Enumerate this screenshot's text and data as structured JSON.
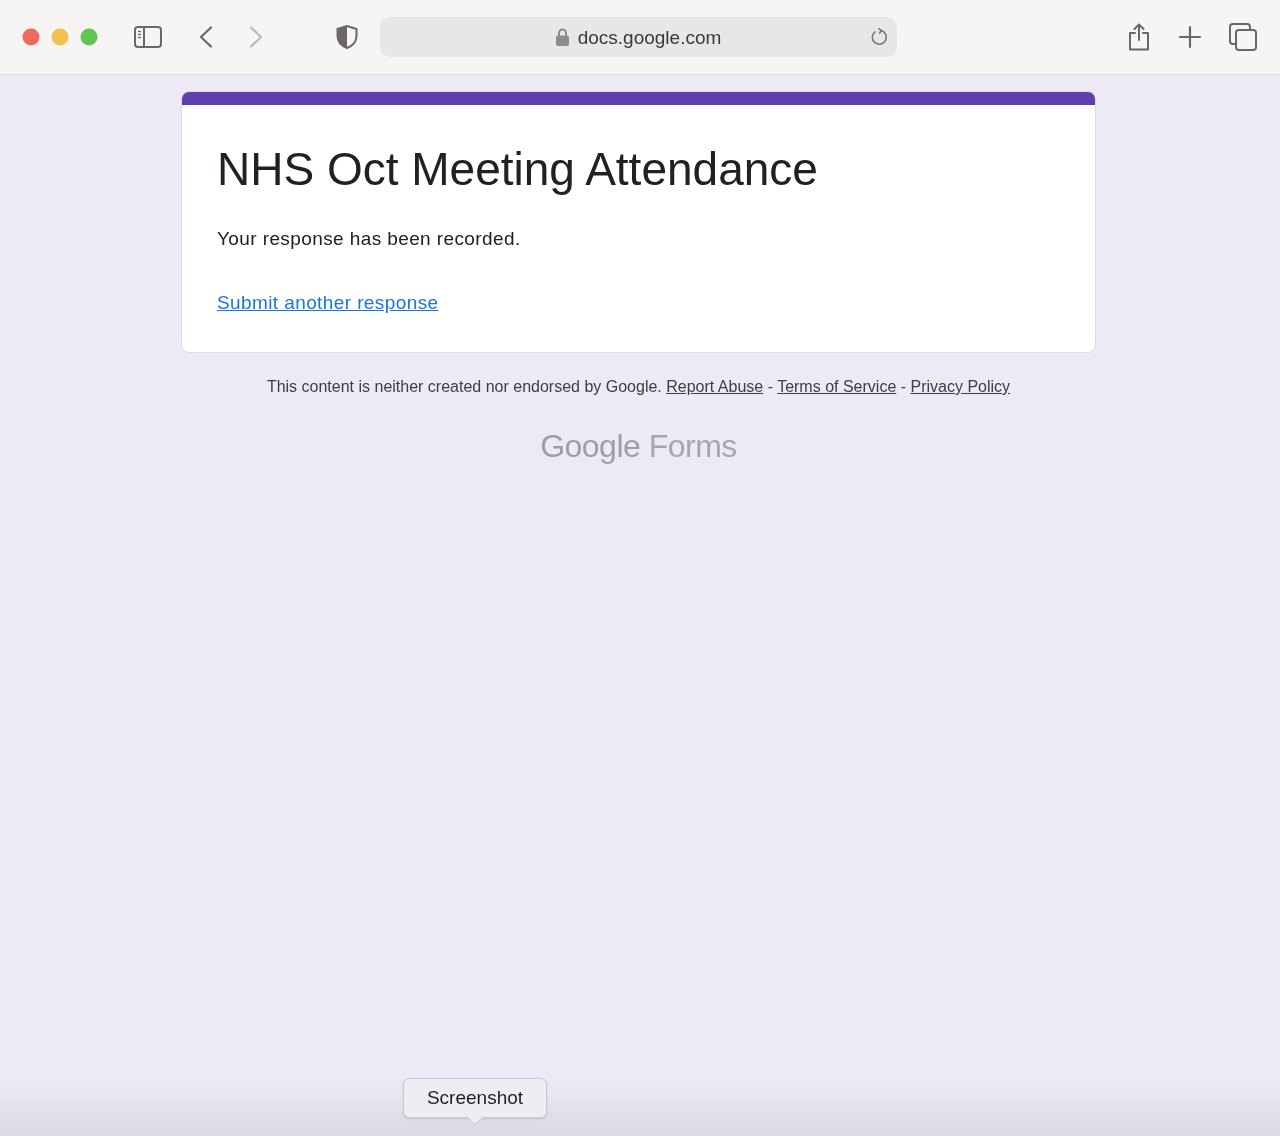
{
  "browser": {
    "url": "docs.google.com",
    "back": {
      "disabled": false
    },
    "forward": {
      "disabled": true
    }
  },
  "form": {
    "title": "NHS Oct Meeting Attendance",
    "confirmation": "Your response has been recorded.",
    "link": "Submit another response"
  },
  "footer": {
    "notice": [
      {
        "kind": "text",
        "text": "This content is neither created nor endorsed by Google."
      },
      {
        "kind": "link",
        "text": "Report Abuse"
      },
      {
        "kind": "text",
        "text": "-"
      },
      {
        "kind": "link",
        "text": "Terms of Service"
      },
      {
        "kind": "text",
        "text": "-"
      },
      {
        "kind": "link",
        "text": "Privacy Policy"
      }
    ],
    "logo": [
      "Google",
      "Forms"
    ]
  },
  "tooltip": {
    "text": "Screenshot"
  }
}
